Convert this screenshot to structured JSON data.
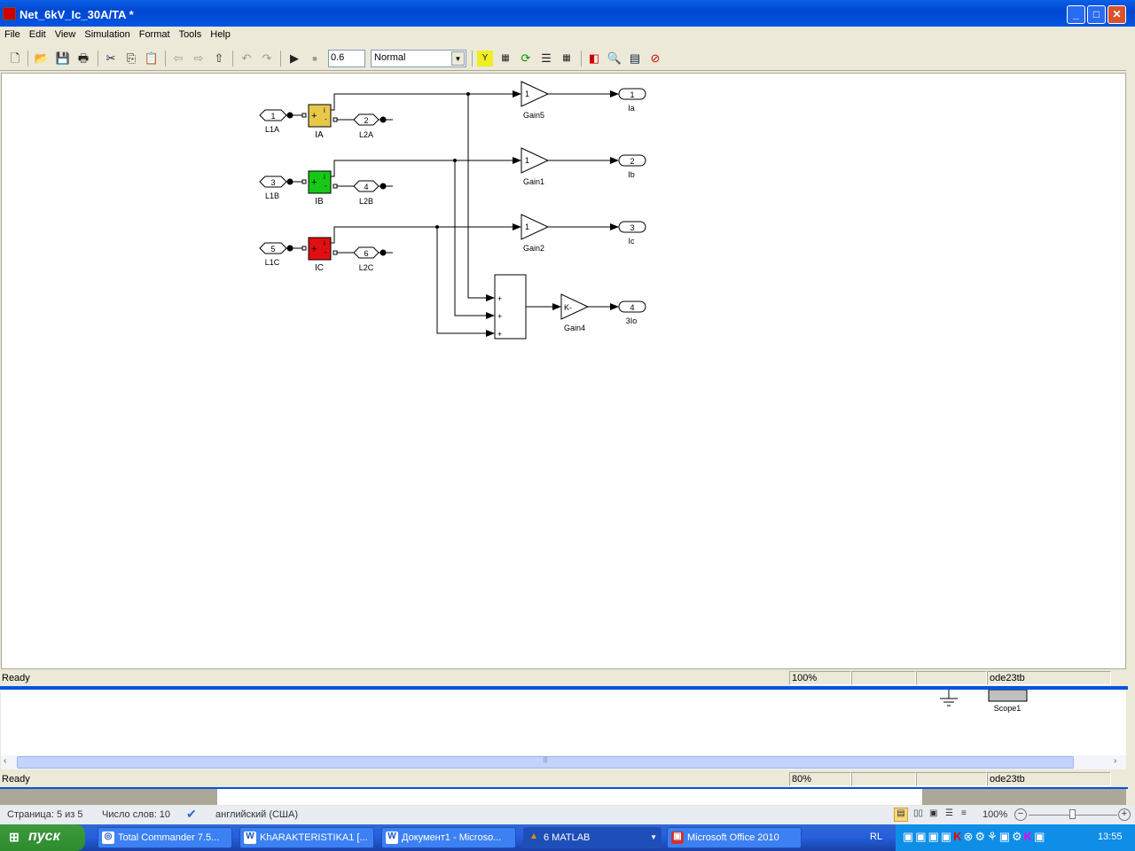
{
  "window": {
    "title": "Net_6kV_Ic_30A/TA *",
    "minimize": "_",
    "maximize": "□",
    "close": "✕"
  },
  "menu": [
    "File",
    "Edit",
    "View",
    "Simulation",
    "Format",
    "Tools",
    "Help"
  ],
  "toolbar": {
    "stop_time": "0.6",
    "sim_mode": "Normal",
    "icons": [
      "new-icon",
      "open-icon",
      "save-icon",
      "print-icon",
      "cut-icon",
      "copy-icon",
      "paste-icon",
      "back-icon",
      "forward-icon",
      "up-icon",
      "undo-icon",
      "redo-icon",
      "run-icon",
      "stop-icon",
      "update-diagram-icon",
      "build-icon",
      "refresh-icon",
      "library-icon",
      "model-explorer-icon",
      "debugger-icon",
      "find-icon",
      "properties-icon",
      "help-icon"
    ]
  },
  "diagram": {
    "phases": [
      {
        "in1": "1",
        "in1_label": "L1A",
        "meter": "IA",
        "in2": "2",
        "in2_label": "L2A",
        "gain": "1",
        "gain_label": "Gain5",
        "out": "1",
        "out_label": "Ia",
        "color": "#e8c84a"
      },
      {
        "in1": "3",
        "in1_label": "L1B",
        "meter": "IB",
        "in2": "4",
        "in2_label": "L2B",
        "gain": "1",
        "gain_label": "Gain1",
        "out": "2",
        "out_label": "Ib",
        "color": "#18c818"
      },
      {
        "in1": "5",
        "in1_label": "L1C",
        "meter": "IC",
        "in2": "6",
        "in2_label": "L2C",
        "gain": "1",
        "gain_label": "Gain2",
        "out": "3",
        "out_label": "Ic",
        "color": "#e01010"
      }
    ],
    "meter_plus": "+",
    "meter_i": "i",
    "meter_minus": "-",
    "sum_signs": [
      "+",
      "+",
      "+"
    ],
    "gain4": {
      "value": "K-",
      "label": "Gain4"
    },
    "out4": {
      "num": "4",
      "label": "3Io"
    }
  },
  "status1": {
    "text": "Ready",
    "zoom": "100%",
    "solver": "ode23tb"
  },
  "window2": {
    "scope_label": "Scope1",
    "scroll_grip": "|||"
  },
  "status2": {
    "text": "Ready",
    "zoom": "80%",
    "solver": "ode23tb"
  },
  "word_status": {
    "page": "Страница: 5 из 5",
    "words": "Число слов: 10",
    "language": "английский (США)",
    "zoom": "100%"
  },
  "taskbar": {
    "start": "пуск",
    "tasks": [
      "Total Commander 7.5...",
      "KhARAKTERISTIKA1 [...",
      "Документ1 - Microso...",
      "6 MATLAB",
      "Microsoft Office 2010"
    ],
    "lang": "RL",
    "clock": "13:55"
  }
}
